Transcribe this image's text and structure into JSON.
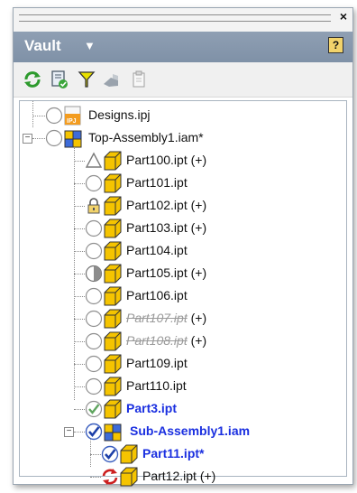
{
  "panel": {
    "title": "Vault",
    "title_arrow": "▼",
    "close_glyph": "×",
    "help_glyph": "?"
  },
  "toolbar": {
    "buttons": [
      {
        "name": "refresh-icon"
      },
      {
        "name": "check-in-icon"
      },
      {
        "name": "filter-icon"
      },
      {
        "name": "disabled-tool-icon"
      },
      {
        "name": "clipboard-icon"
      }
    ]
  },
  "tree": {
    "items": [
      {
        "label": "Designs.ipj",
        "status": "empty",
        "type": "project",
        "style": "normal"
      },
      {
        "label": "Top-Assembly1.iam*",
        "status": "empty",
        "type": "assembly",
        "style": "normal"
      },
      {
        "label": "Part100.ipt (+)",
        "status": "triangle",
        "type": "part",
        "style": "normal"
      },
      {
        "label": "Part101.ipt",
        "status": "empty",
        "type": "part",
        "style": "normal"
      },
      {
        "label": "Part102.ipt (+)",
        "status": "lock",
        "type": "part",
        "style": "normal"
      },
      {
        "label": "Part103.ipt (+)",
        "status": "empty",
        "type": "part",
        "style": "normal"
      },
      {
        "label": "Part104.ipt",
        "status": "empty",
        "type": "part",
        "style": "normal"
      },
      {
        "label": "Part105.ipt (+)",
        "status": "half",
        "type": "part",
        "style": "normal"
      },
      {
        "label": "Part106.ipt",
        "status": "empty",
        "type": "part",
        "style": "normal"
      },
      {
        "label": "Part107.ipt",
        "suffix": " (+)",
        "status": "empty",
        "type": "part",
        "style": "struck"
      },
      {
        "label": "Part108.ipt",
        "suffix": " (+)",
        "status": "empty",
        "type": "part",
        "style": "struck"
      },
      {
        "label": "Part109.ipt",
        "status": "empty",
        "type": "part",
        "style": "normal"
      },
      {
        "label": "Part110.ipt",
        "status": "empty",
        "type": "part",
        "style": "normal"
      },
      {
        "label": "Part3.ipt",
        "status": "checked-gray",
        "type": "part",
        "style": "bold"
      },
      {
        "label": "Sub-Assembly1.iam",
        "status": "checked-blue",
        "type": "assembly",
        "style": "bold"
      },
      {
        "label": "Part11.ipt*",
        "status": "checked-blue",
        "type": "part",
        "style": "bold"
      },
      {
        "label": "Part12.ipt (+)",
        "status": "refresh-red",
        "type": "part",
        "style": "normal"
      }
    ]
  },
  "colors": {
    "title_bg": "#8495ab",
    "bold_text": "#1a2fe0",
    "part_yellow": "#f5c400"
  }
}
